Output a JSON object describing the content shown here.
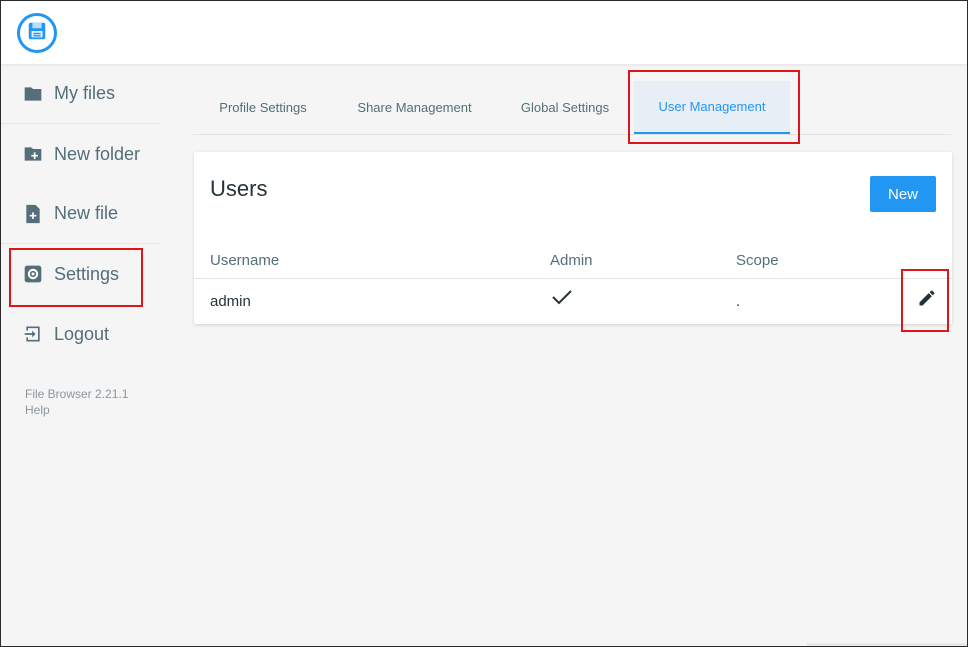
{
  "app": {
    "logo_icon": "floppy-disk-icon",
    "accent": "#2196f3"
  },
  "sidebar": {
    "items": [
      {
        "label": "My files",
        "icon": "folder-icon"
      },
      {
        "label": "New folder",
        "icon": "create-new-folder-icon"
      },
      {
        "label": "New file",
        "icon": "note-add-icon"
      },
      {
        "label": "Settings",
        "icon": "settings-icon"
      },
      {
        "label": "Logout",
        "icon": "exit-icon"
      }
    ],
    "footer": {
      "version": "File Browser 2.21.1",
      "help": "Help"
    }
  },
  "settings": {
    "tabs": [
      {
        "label": "Profile Settings"
      },
      {
        "label": "Share Management"
      },
      {
        "label": "Global Settings"
      },
      {
        "label": "User Management",
        "active": true
      }
    ]
  },
  "users": {
    "title": "Users",
    "new_label": "New",
    "columns": {
      "username": "Username",
      "admin": "Admin",
      "scope": "Scope"
    },
    "rows": [
      {
        "username": "admin",
        "admin_icon": "check-icon",
        "scope": "."
      }
    ]
  },
  "annotations": {
    "highlight_color": "#e0151b"
  }
}
